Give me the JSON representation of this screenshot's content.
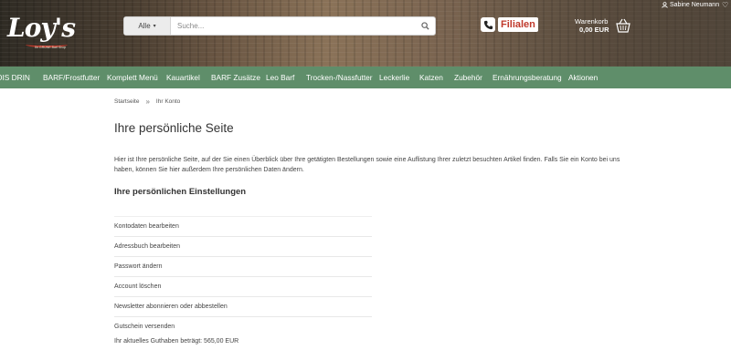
{
  "header": {
    "logo_text": "Loy's",
    "logo_tagline": "Ihr GRÜNE Barf Shop",
    "search": {
      "category": "Alle",
      "placeholder": "Suche..."
    },
    "filialen_label": "Filialen",
    "cart": {
      "label": "Warenkorb",
      "value": "0,00 EUR"
    },
    "user_name": "Sabine Neumann"
  },
  "nav": {
    "items": [
      "OIS DRIN",
      "BARF/Frostfutter",
      "Komplett Menü",
      "Kauartikel",
      "BARF Zusätze",
      "Leo Barf",
      "Trocken-/Nassfutter",
      "Leckerlie",
      "Katzen",
      "Zubehör",
      "Ernährungsberatung",
      "Aktionen"
    ]
  },
  "breadcrumb": {
    "home": "Startseite",
    "separator": "»",
    "current": "Ihr Konto"
  },
  "main": {
    "title": "Ihre persönliche Seite",
    "intro": "Hier ist Ihre persönliche Seite, auf der Sie einen Überblick über Ihre getätigten Bestellungen sowie eine Auflistung Ihrer zuletzt besuchten Artikel finden. Falls Sie ein Konto bei uns haben, können Sie hier außerdem Ihre persönlichen Daten ändern.",
    "settings_title": "Ihre persönlichen Einstellungen",
    "settings_items": [
      "Kontodaten bearbeiten",
      "Adressbuch bearbeiten",
      "Passwort ändern",
      "Account löschen",
      "Newsletter abonnieren oder abbestellen",
      "Gutschein versenden"
    ],
    "balance": "Ihr aktuelles Guthaben beträgt: 565,00 EUR"
  },
  "colors": {
    "nav_bg": "#5f8e6a",
    "filialen_red": "#c0392b",
    "header_wood": "#6a5643"
  }
}
